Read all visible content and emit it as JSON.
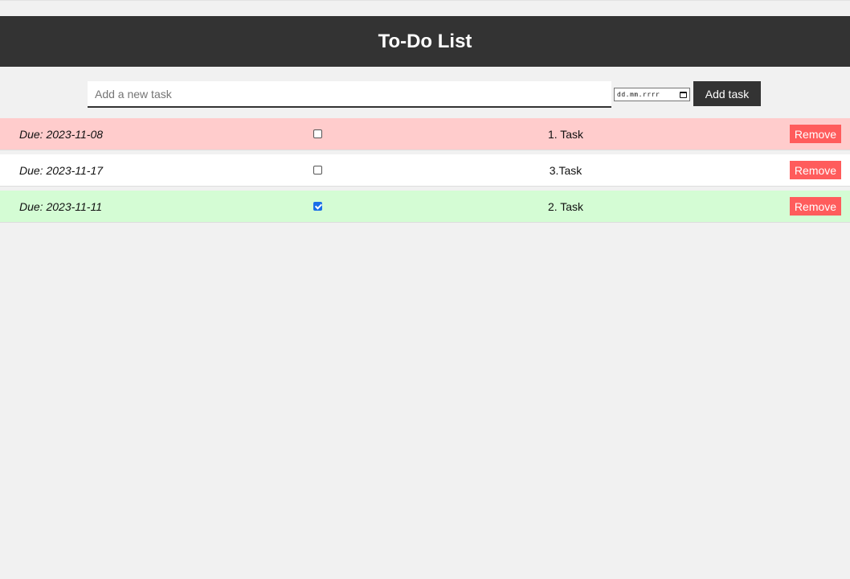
{
  "header": {
    "title": "To-Do List"
  },
  "new_task": {
    "placeholder": "Add a new task",
    "date_placeholder": "dd.mm.rrrr",
    "add_label": "Add task"
  },
  "tasks": [
    {
      "due": "Due: 2023-11-08",
      "name": "1. Task",
      "checked": false,
      "color": "#ffcccc",
      "remove_label": "Remove"
    },
    {
      "due": "Due: 2023-11-17",
      "name": "3.Task",
      "checked": false,
      "color": "#ffffff",
      "remove_label": "Remove"
    },
    {
      "due": "Due: 2023-11-11",
      "name": "2. Task",
      "checked": true,
      "color": "#d4fcd4",
      "remove_label": "Remove"
    }
  ],
  "colors": {
    "header_bg": "#333333",
    "remove_button": "#ff5c5c",
    "checkbox_checked": "#1a6ee8"
  }
}
